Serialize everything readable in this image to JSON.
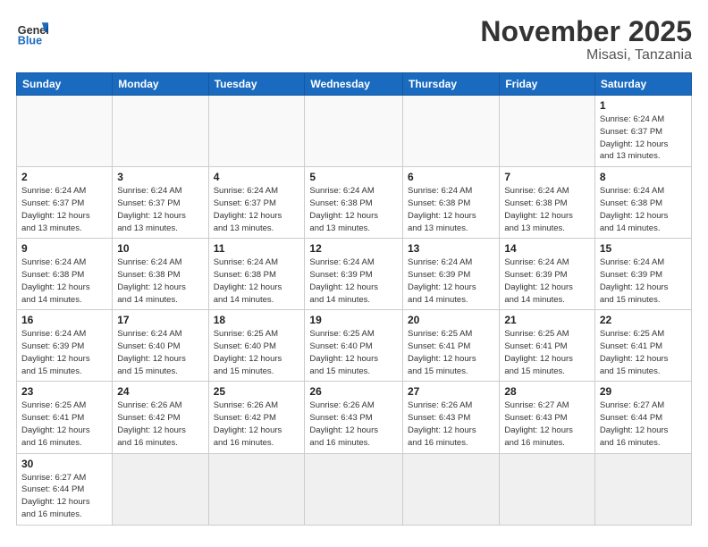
{
  "header": {
    "logo_general": "General",
    "logo_blue": "Blue",
    "month_title": "November 2025",
    "location": "Misasi, Tanzania"
  },
  "days_of_week": [
    "Sunday",
    "Monday",
    "Tuesday",
    "Wednesday",
    "Thursday",
    "Friday",
    "Saturday"
  ],
  "weeks": [
    [
      {
        "day": "",
        "info": ""
      },
      {
        "day": "",
        "info": ""
      },
      {
        "day": "",
        "info": ""
      },
      {
        "day": "",
        "info": ""
      },
      {
        "day": "",
        "info": ""
      },
      {
        "day": "",
        "info": ""
      },
      {
        "day": "1",
        "info": "Sunrise: 6:24 AM\nSunset: 6:37 PM\nDaylight: 12 hours\nand 13 minutes."
      }
    ],
    [
      {
        "day": "2",
        "info": "Sunrise: 6:24 AM\nSunset: 6:37 PM\nDaylight: 12 hours\nand 13 minutes."
      },
      {
        "day": "3",
        "info": "Sunrise: 6:24 AM\nSunset: 6:37 PM\nDaylight: 12 hours\nand 13 minutes."
      },
      {
        "day": "4",
        "info": "Sunrise: 6:24 AM\nSunset: 6:37 PM\nDaylight: 12 hours\nand 13 minutes."
      },
      {
        "day": "5",
        "info": "Sunrise: 6:24 AM\nSunset: 6:38 PM\nDaylight: 12 hours\nand 13 minutes."
      },
      {
        "day": "6",
        "info": "Sunrise: 6:24 AM\nSunset: 6:38 PM\nDaylight: 12 hours\nand 13 minutes."
      },
      {
        "day": "7",
        "info": "Sunrise: 6:24 AM\nSunset: 6:38 PM\nDaylight: 12 hours\nand 13 minutes."
      },
      {
        "day": "8",
        "info": "Sunrise: 6:24 AM\nSunset: 6:38 PM\nDaylight: 12 hours\nand 14 minutes."
      }
    ],
    [
      {
        "day": "9",
        "info": "Sunrise: 6:24 AM\nSunset: 6:38 PM\nDaylight: 12 hours\nand 14 minutes."
      },
      {
        "day": "10",
        "info": "Sunrise: 6:24 AM\nSunset: 6:38 PM\nDaylight: 12 hours\nand 14 minutes."
      },
      {
        "day": "11",
        "info": "Sunrise: 6:24 AM\nSunset: 6:38 PM\nDaylight: 12 hours\nand 14 minutes."
      },
      {
        "day": "12",
        "info": "Sunrise: 6:24 AM\nSunset: 6:39 PM\nDaylight: 12 hours\nand 14 minutes."
      },
      {
        "day": "13",
        "info": "Sunrise: 6:24 AM\nSunset: 6:39 PM\nDaylight: 12 hours\nand 14 minutes."
      },
      {
        "day": "14",
        "info": "Sunrise: 6:24 AM\nSunset: 6:39 PM\nDaylight: 12 hours\nand 14 minutes."
      },
      {
        "day": "15",
        "info": "Sunrise: 6:24 AM\nSunset: 6:39 PM\nDaylight: 12 hours\nand 15 minutes."
      }
    ],
    [
      {
        "day": "16",
        "info": "Sunrise: 6:24 AM\nSunset: 6:39 PM\nDaylight: 12 hours\nand 15 minutes."
      },
      {
        "day": "17",
        "info": "Sunrise: 6:24 AM\nSunset: 6:40 PM\nDaylight: 12 hours\nand 15 minutes."
      },
      {
        "day": "18",
        "info": "Sunrise: 6:25 AM\nSunset: 6:40 PM\nDaylight: 12 hours\nand 15 minutes."
      },
      {
        "day": "19",
        "info": "Sunrise: 6:25 AM\nSunset: 6:40 PM\nDaylight: 12 hours\nand 15 minutes."
      },
      {
        "day": "20",
        "info": "Sunrise: 6:25 AM\nSunset: 6:41 PM\nDaylight: 12 hours\nand 15 minutes."
      },
      {
        "day": "21",
        "info": "Sunrise: 6:25 AM\nSunset: 6:41 PM\nDaylight: 12 hours\nand 15 minutes."
      },
      {
        "day": "22",
        "info": "Sunrise: 6:25 AM\nSunset: 6:41 PM\nDaylight: 12 hours\nand 15 minutes."
      }
    ],
    [
      {
        "day": "23",
        "info": "Sunrise: 6:25 AM\nSunset: 6:41 PM\nDaylight: 12 hours\nand 16 minutes."
      },
      {
        "day": "24",
        "info": "Sunrise: 6:26 AM\nSunset: 6:42 PM\nDaylight: 12 hours\nand 16 minutes."
      },
      {
        "day": "25",
        "info": "Sunrise: 6:26 AM\nSunset: 6:42 PM\nDaylight: 12 hours\nand 16 minutes."
      },
      {
        "day": "26",
        "info": "Sunrise: 6:26 AM\nSunset: 6:43 PM\nDaylight: 12 hours\nand 16 minutes."
      },
      {
        "day": "27",
        "info": "Sunrise: 6:26 AM\nSunset: 6:43 PM\nDaylight: 12 hours\nand 16 minutes."
      },
      {
        "day": "28",
        "info": "Sunrise: 6:27 AM\nSunset: 6:43 PM\nDaylight: 12 hours\nand 16 minutes."
      },
      {
        "day": "29",
        "info": "Sunrise: 6:27 AM\nSunset: 6:44 PM\nDaylight: 12 hours\nand 16 minutes."
      }
    ],
    [
      {
        "day": "30",
        "info": "Sunrise: 6:27 AM\nSunset: 6:44 PM\nDaylight: 12 hours\nand 16 minutes."
      },
      {
        "day": "",
        "info": ""
      },
      {
        "day": "",
        "info": ""
      },
      {
        "day": "",
        "info": ""
      },
      {
        "day": "",
        "info": ""
      },
      {
        "day": "",
        "info": ""
      },
      {
        "day": "",
        "info": ""
      }
    ]
  ]
}
